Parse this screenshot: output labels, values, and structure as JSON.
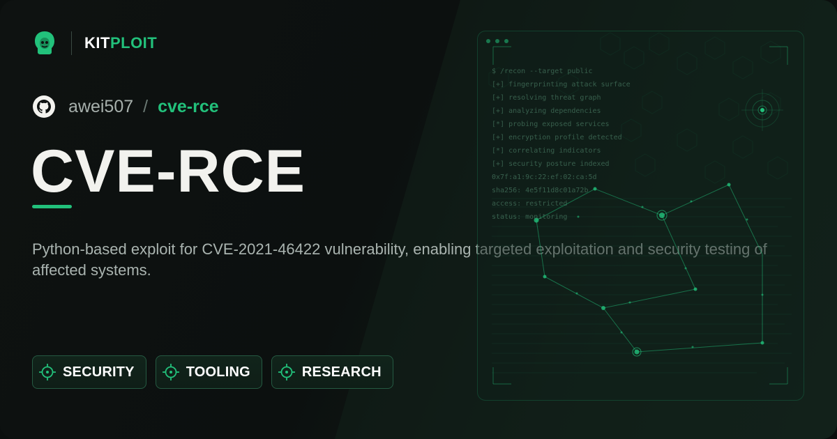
{
  "brand": {
    "kit": "KIT",
    "ploit": "PLOIT",
    "icon": "kitploit-logo-icon"
  },
  "repo": {
    "icon": "github-icon",
    "owner": "awei507",
    "separator": "/",
    "name": "cve-rce"
  },
  "title": "CVE-RCE",
  "description": "Python-based exploit for CVE-2021-46422 vulnerability, enabling targeted exploitation and security testing of affected systems.",
  "tags": [
    {
      "label": "SECURITY",
      "icon": "crosshair-icon"
    },
    {
      "label": "TOOLING",
      "icon": "crosshair-icon"
    },
    {
      "label": "RESEARCH",
      "icon": "crosshair-icon"
    }
  ],
  "terminal": {
    "lines": [
      "$ /recon --target public",
      "[+] fingerprinting attack surface",
      "[+] resolving threat graph",
      "[+] analyzing dependencies",
      "[*] probing exposed services",
      "[+] encryption profile detected",
      "[*] correlating indicators",
      "[+] security posture indexed",
      "0x7f:a1:9c:22:ef:02:ca:5d",
      "sha256: 4e5f11d8c01a72b",
      "access: restricted",
      "status: monitoring"
    ]
  },
  "colors": {
    "accent": "#22c17b",
    "background": "#0e1211",
    "title": "#f2f2ee",
    "muted_text": "#aab4b0"
  }
}
